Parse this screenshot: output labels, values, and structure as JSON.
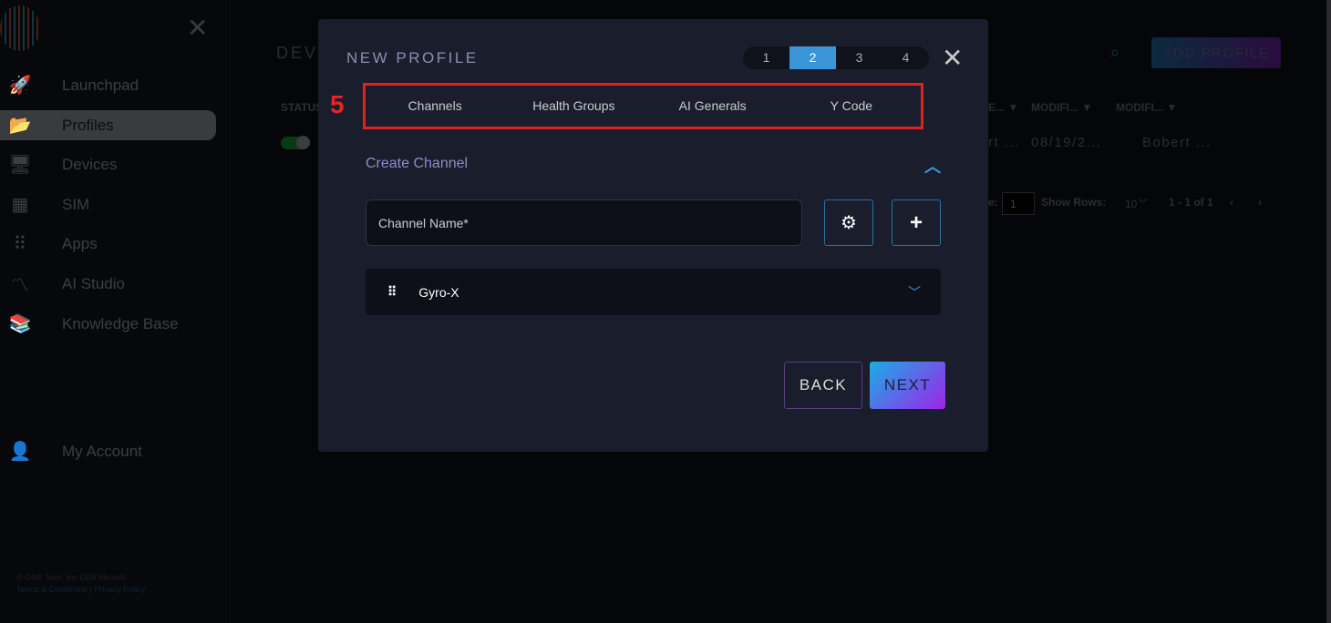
{
  "sidebar": {
    "items": [
      {
        "label": "Launchpad",
        "icon": "rocket-icon"
      },
      {
        "label": "Profiles",
        "icon": "folder-icon",
        "active": true
      },
      {
        "label": "Devices",
        "icon": "monitor-icon"
      },
      {
        "label": "SIM",
        "icon": "sim-icon"
      },
      {
        "label": "Apps",
        "icon": "grid-icon"
      },
      {
        "label": "AI Studio",
        "icon": "ai-studio-icon"
      },
      {
        "label": "Knowledge Base",
        "icon": "books-icon"
      }
    ],
    "account": "My Account",
    "copyright": "© ONE Tech, Inc DBA MicroAI",
    "terms": "Terms & Conditions",
    "separator": "|",
    "privacy": "Privacy Policy"
  },
  "page": {
    "title": "DEVI",
    "add_profile": "ADD PROFILE",
    "columns": [
      "STATUS",
      "E...",
      "MODIFI...",
      "MODIFI..."
    ],
    "row": [
      "rt ...",
      "08/19/2...",
      "Bobert ..."
    ],
    "page_label": "e:",
    "page_value": "1",
    "show_rows_label": "Show Rows:",
    "show_rows_value": "10",
    "range": "1 - 1 of 1"
  },
  "modal": {
    "title": "NEW PROFILE",
    "steps": [
      "1",
      "2",
      "3",
      "4"
    ],
    "active_step": 2,
    "annotation": "5",
    "tabs": [
      "Channels",
      "Health Groups",
      "AI Generals",
      "Y Code"
    ],
    "section": "Create Channel",
    "channel_placeholder": "Channel Name*",
    "channels": [
      {
        "name": "Gyro-X"
      }
    ],
    "back": "BACK",
    "next": "NEXT"
  },
  "colors": {
    "accent": "#3a95d6",
    "annotation": "#e0211c",
    "modal_bg": "#1a1d2c"
  }
}
